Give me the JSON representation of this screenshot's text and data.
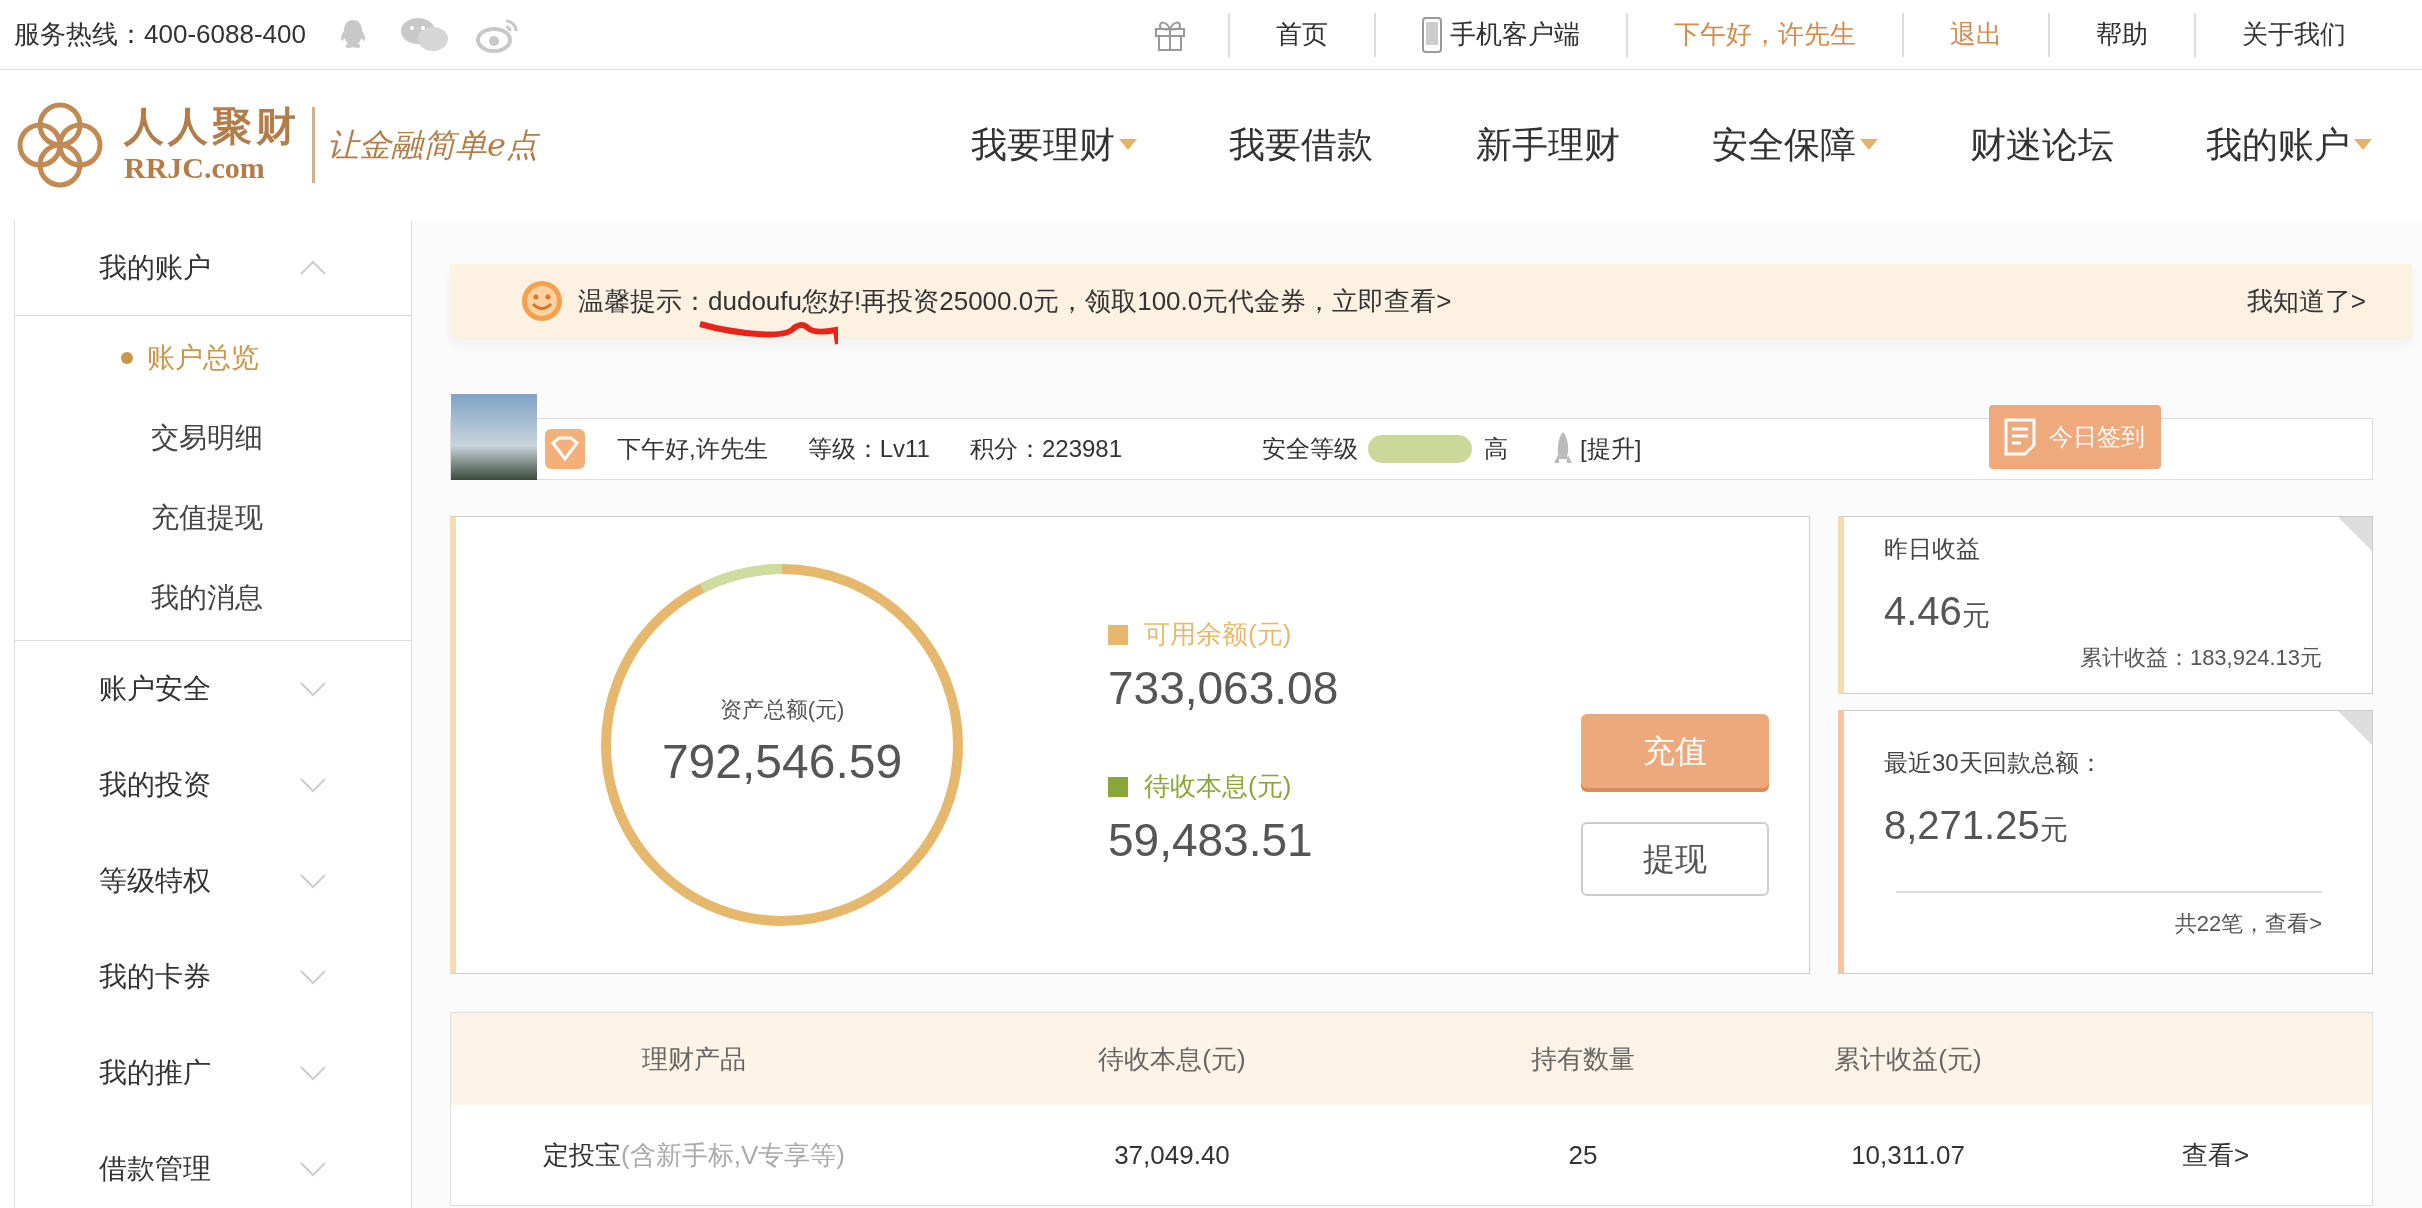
{
  "top_bar": {
    "hotline": "服务热线：400-6088-400",
    "links": [
      {
        "label": "首页",
        "kind": "plain",
        "highlight": false
      },
      {
        "label": "手机客户端",
        "kind": "phone",
        "highlight": false
      },
      {
        "label": "下午好，许先生",
        "kind": "plain",
        "highlight": true
      },
      {
        "label": "退出",
        "kind": "plain",
        "highlight": true
      },
      {
        "label": "帮助",
        "kind": "plain",
        "highlight": false
      },
      {
        "label": "关于我们",
        "kind": "plain",
        "highlight": false
      }
    ]
  },
  "logo": {
    "name": "人人聚财",
    "domain": "RRJC.com",
    "slogan": "让金融简单e点"
  },
  "nav": [
    {
      "label": "我要理财",
      "dropdown": true
    },
    {
      "label": "我要借款",
      "dropdown": false
    },
    {
      "label": "新手理财",
      "dropdown": false
    },
    {
      "label": "安全保障",
      "dropdown": true
    },
    {
      "label": "财迷论坛",
      "dropdown": false
    },
    {
      "label": "我的账户",
      "dropdown": true
    }
  ],
  "sidebar": {
    "items": [
      {
        "label": "我的账户",
        "expanded": true,
        "children": [
          {
            "label": "账户总览",
            "selected": true
          },
          {
            "label": "交易明细",
            "selected": false
          },
          {
            "label": "充值提现",
            "selected": false
          },
          {
            "label": "我的消息",
            "selected": false
          }
        ]
      },
      {
        "label": "账户安全",
        "expanded": false
      },
      {
        "label": "我的投资",
        "expanded": false
      },
      {
        "label": "等级特权",
        "expanded": false
      },
      {
        "label": "我的卡券",
        "expanded": false
      },
      {
        "label": "我的推广",
        "expanded": false
      },
      {
        "label": "借款管理",
        "expanded": false
      }
    ]
  },
  "notice": {
    "text": "温馨提示：dudoufu您好!再投资25000.0元，领取100.0元代金券，立即查看>",
    "dismiss": "我知道了>"
  },
  "profile": {
    "greeting": "下午好,许先生",
    "grade": "等级：Lv11",
    "points": "积分：223981",
    "security": {
      "label": "安全等级",
      "level": 1,
      "rating": "高"
    },
    "upgrade": "[提升]",
    "checkin": "今日签到"
  },
  "assets": {
    "total_label": "资产总额(元)",
    "total": "792,546.59",
    "items": [
      {
        "label": "可用余额(元)",
        "value": "733,063.08",
        "color": "#e6b86e"
      },
      {
        "label": "待收本息(元)",
        "value": "59,483.51",
        "color": "#8aa53a"
      }
    ],
    "buttons": [
      {
        "label": "充值",
        "kind": "primary"
      },
      {
        "label": "提现",
        "kind": "secondary"
      }
    ]
  },
  "stats": [
    {
      "title": "昨日收益",
      "value": "4.46",
      "unit": "元",
      "footer": "累计收益：183,924.13元",
      "kind": "total",
      "color": "#f3dcb0"
    },
    {
      "title": "最近30天回款总额：",
      "value": "8,271.25",
      "unit": "元",
      "footer": "共22笔，查看>",
      "kind": "link",
      "color": "#f7c3a0"
    }
  ],
  "table": {
    "columns": [
      "理财产品",
      "待收本息(元)",
      "持有数量",
      "累计收益(元)"
    ],
    "rows": [
      {
        "cells": [
          "定投宝",
          "37,049.40",
          "25",
          "10,311.07"
        ],
        "note": "(含新手标,V专享等)",
        "action": "查看>"
      }
    ]
  }
}
